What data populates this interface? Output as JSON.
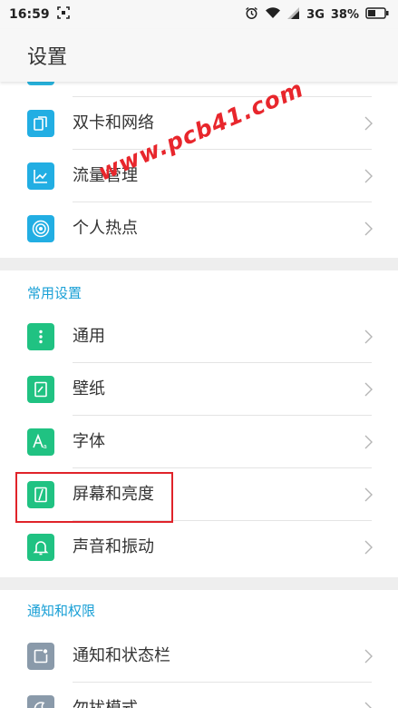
{
  "status_bar": {
    "time": "16:59",
    "network": "3G",
    "battery": "38%"
  },
  "header": {
    "title": "设置"
  },
  "group1": {
    "items": [
      {
        "label": "双卡和网络",
        "icon": "sim-card-icon"
      },
      {
        "label": "流量管理",
        "icon": "data-usage-icon"
      },
      {
        "label": "个人热点",
        "icon": "hotspot-icon"
      }
    ]
  },
  "group2": {
    "title": "常用设置",
    "items": [
      {
        "label": "通用",
        "icon": "more-vertical-icon"
      },
      {
        "label": "壁纸",
        "icon": "wallpaper-icon"
      },
      {
        "label": "字体",
        "icon": "font-icon"
      },
      {
        "label": "屏幕和亮度",
        "icon": "display-icon"
      },
      {
        "label": "声音和振动",
        "icon": "bell-icon"
      }
    ]
  },
  "group3": {
    "title": "通知和权限",
    "items": [
      {
        "label": "通知和状态栏",
        "icon": "notification-icon"
      },
      {
        "label": "勿扰模式",
        "icon": "do-not-disturb-icon"
      }
    ]
  },
  "watermark": "www.pcb41.com",
  "colors": {
    "accent_blue": "#22aee3",
    "accent_green": "#20c282",
    "section_title": "#1aa0d6",
    "highlight_red": "#e0232a"
  }
}
